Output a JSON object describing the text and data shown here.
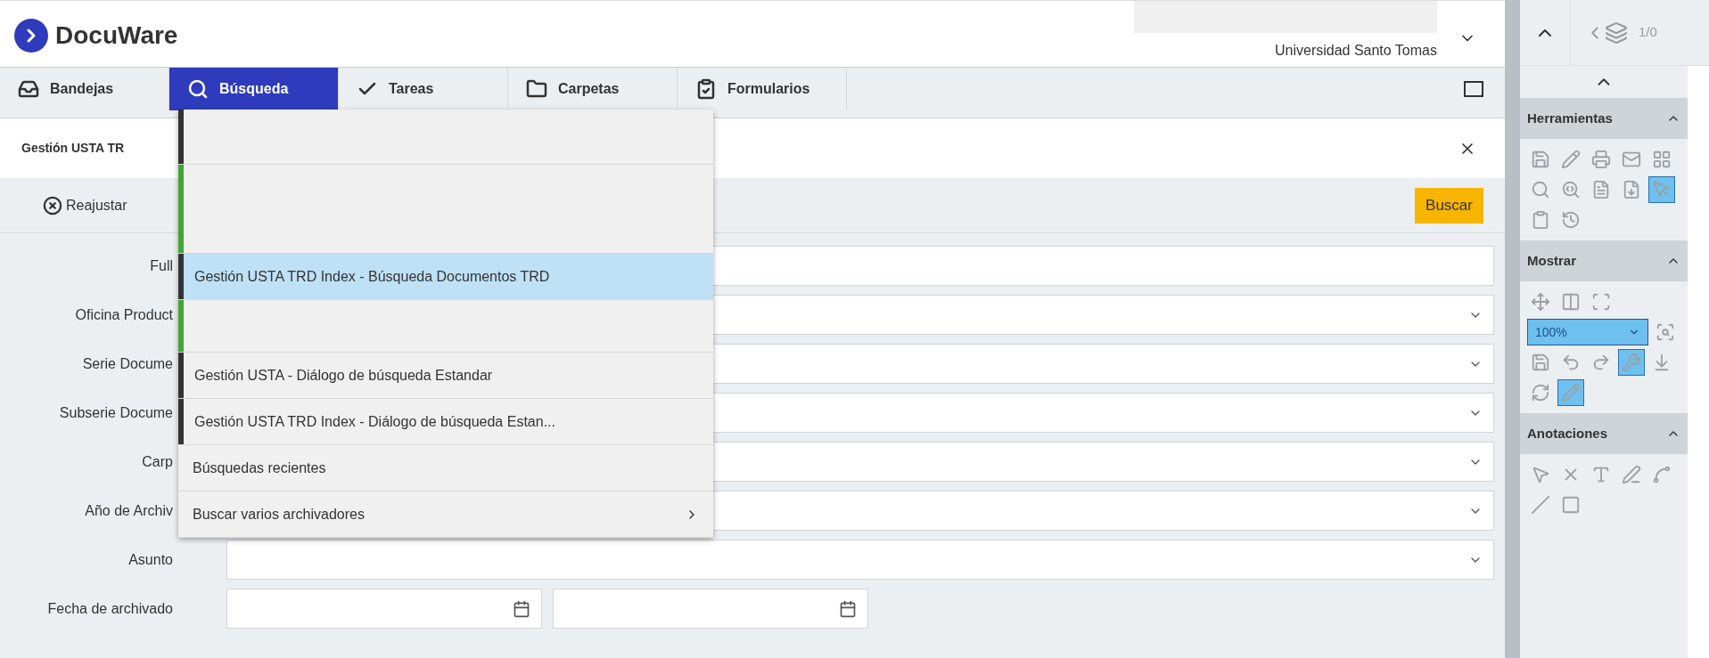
{
  "header": {
    "logo": "DocuWare",
    "organization": "Universidad Santo Tomas"
  },
  "nav": [
    {
      "label": "Bandejas",
      "selected": false
    },
    {
      "label": "Búsqueda",
      "selected": true
    },
    {
      "label": "Tareas",
      "selected": false
    },
    {
      "label": "Carpetas",
      "selected": false
    },
    {
      "label": "Formularios",
      "selected": false
    }
  ],
  "panel": {
    "title": "Gestión USTA TR",
    "reset": "Reajustar",
    "search": "Buscar"
  },
  "fields": [
    {
      "label": "Full",
      "kind": "text"
    },
    {
      "label": "Oficina Product",
      "kind": "select"
    },
    {
      "label": "Serie Docume",
      "kind": "select"
    },
    {
      "label": "Subserie Docume",
      "kind": "select"
    },
    {
      "label": "Carp",
      "kind": "select"
    },
    {
      "label": "Año de Archiv",
      "kind": "select"
    },
    {
      "label": "Asunto",
      "kind": "select"
    },
    {
      "label": "Fecha de archivado",
      "kind": "date_range"
    }
  ],
  "dropdown": [
    {
      "kind": "blank",
      "color": "#333333",
      "selected": false
    },
    {
      "kind": "blank",
      "color": "#3fa535",
      "selected": false
    },
    {
      "kind": "entry",
      "label": "Gestión USTA TRD Index - Búsqueda Documentos TRD",
      "color": "#333333",
      "selected": true
    },
    {
      "kind": "blank",
      "color": "#3fa535",
      "selected": false
    },
    {
      "kind": "entry",
      "label": "Gestión USTA - Diálogo de búsqueda Estandar",
      "color": "#333333",
      "selected": false
    },
    {
      "kind": "entry",
      "label": "Gestión USTA TRD Index - Diálogo de búsqueda Estan...",
      "color": "#333333",
      "selected": false
    },
    {
      "kind": "plain",
      "label": "Búsquedas recientes",
      "selected": false
    },
    {
      "kind": "submenu",
      "label": "Buscar varios archivadores",
      "selected": false
    }
  ],
  "viewer": {
    "page": "1/0",
    "sections": [
      {
        "title": "Herramientas",
        "tools": [
          {
            "selected": false
          },
          {
            "selected": false
          },
          {
            "selected": false
          },
          {
            "selected": false
          },
          {
            "selected": false
          },
          {
            "selected": false
          },
          {
            "selected": false
          },
          {
            "selected": false
          },
          {
            "selected": false
          },
          {
            "selected": true
          },
          {
            "selected": false
          },
          {
            "selected": false
          }
        ]
      },
      {
        "title": "Mostrar",
        "zoom": "100%",
        "tools": [
          {
            "selected": false
          },
          {
            "selected": false
          },
          {
            "selected": false
          },
          {
            "selected": false
          },
          {
            "selected": false
          },
          {
            "selected": false
          },
          {
            "selected": false
          },
          {
            "selected": true
          },
          {
            "selected": false
          },
          {
            "selected": false
          },
          {
            "selected": true
          }
        ]
      },
      {
        "title": "Anotaciones",
        "tools": [
          {
            "selected": false
          },
          {
            "selected": false
          },
          {
            "selected": false
          },
          {
            "selected": false
          },
          {
            "selected": false
          },
          {
            "selected": false
          },
          {
            "selected": false
          }
        ]
      }
    ]
  }
}
